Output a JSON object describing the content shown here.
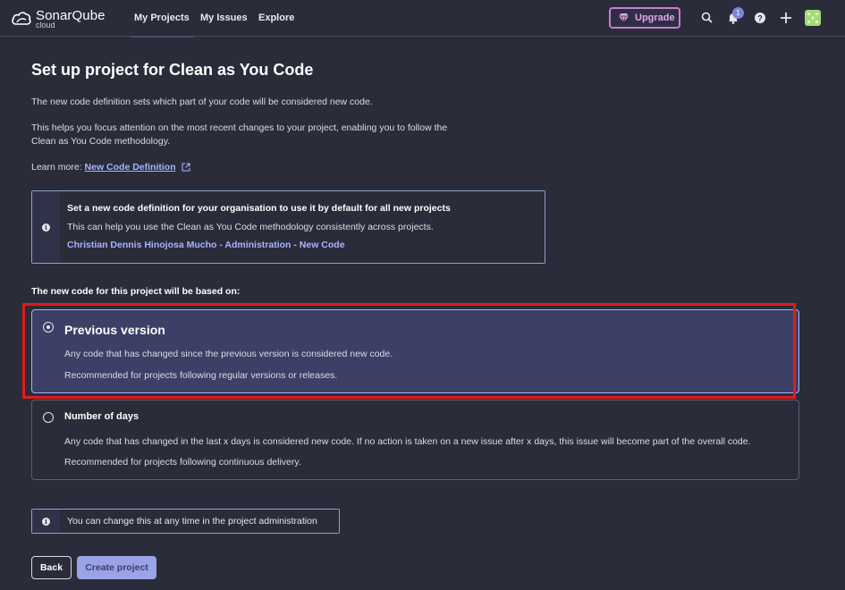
{
  "header": {
    "brand": "SonarQube",
    "brand_sub": "cloud",
    "nav": [
      {
        "label": "My Projects",
        "active": true
      },
      {
        "label": "My Issues",
        "active": false
      },
      {
        "label": "Explore",
        "active": false
      }
    ],
    "upgrade_label": "Upgrade",
    "notification_count": "1",
    "icons": [
      "search-icon",
      "bell-icon",
      "help-icon",
      "plus-icon",
      "avatar"
    ]
  },
  "main": {
    "title": "Set up project for Clean as You Code",
    "intro_1": "The new code definition sets which part of your code will be considered new code.",
    "intro_2": "This helps you focus attention on the most recent changes to your project, enabling you to follow the Clean as You Code methodology.",
    "learn_more_label": "Learn more:",
    "learn_more_link": "New Code Definition",
    "info_box": {
      "heading": "Set a new code definition for your organisation to use it by default for all new projects",
      "body": "This can help you use the Clean as You Code methodology consistently across projects.",
      "link": "Christian Dennis Hinojosa Mucho - Administration - New Code"
    },
    "based_on_label": "The new code for this project will be based on:",
    "options": [
      {
        "title": "Previous version",
        "desc_1": "Any code that has changed since the previous version is considered new code.",
        "desc_2": "Recommended for projects following regular versions or releases.",
        "selected": true
      },
      {
        "title": "Number of days",
        "desc_1": "Any code that has changed in the last x days is considered new code. If no action is taken on a new issue after x days, this issue will become part of the overall code.",
        "desc_2": "Recommended for projects following continuous delivery.",
        "selected": false
      }
    ],
    "note": "You can change this at any time in the project administration",
    "back_label": "Back",
    "create_label": "Create project"
  },
  "colors": {
    "background": "#2a2c3a",
    "accent": "#a7b3ff",
    "selected_option": "#3c3f66",
    "highlight": "#e01b1b",
    "upgrade": "#c77dd6"
  }
}
